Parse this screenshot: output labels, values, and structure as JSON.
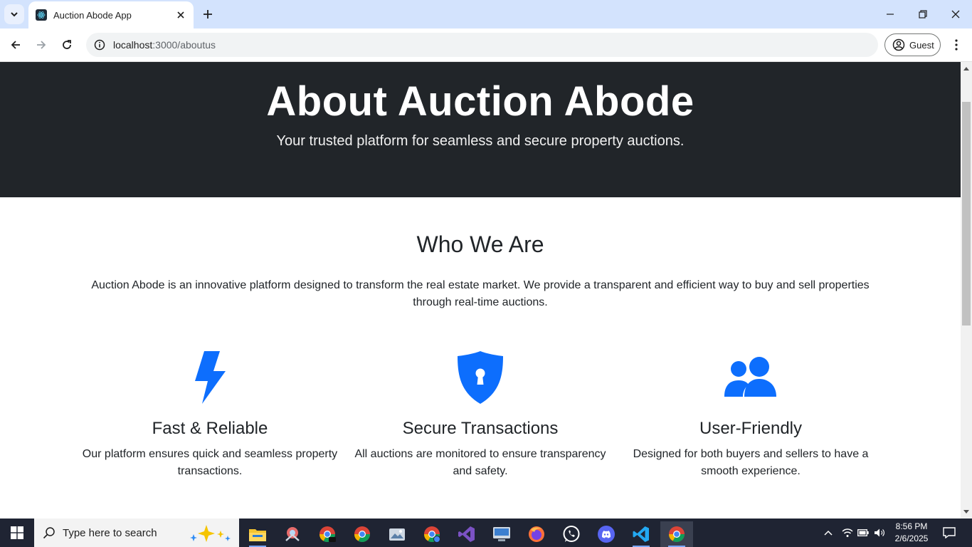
{
  "browser": {
    "tab_title": "Auction Abode App",
    "url_host": "localhost",
    "url_rest": ":3000/aboutus",
    "profile_label": "Guest"
  },
  "hero": {
    "title": "About Auction Abode",
    "subtitle": "Your trusted platform for seamless and secure property auctions."
  },
  "who": {
    "title": "Who We Are",
    "text": "Auction Abode is an innovative platform designed to transform the real estate market. We provide a transparent and efficient way to buy and sell properties through real-time auctions."
  },
  "features": [
    {
      "icon": "lightning-icon",
      "title": "Fast & Reliable",
      "text": "Our platform ensures quick and seamless property transactions."
    },
    {
      "icon": "shield-lock-icon",
      "title": "Secure Transactions",
      "text": "All auctions are monitored to ensure transparency and safety."
    },
    {
      "icon": "users-icon",
      "title": "User-Friendly",
      "text": "Designed for both buyers and sellers to have a smooth experience."
    }
  ],
  "colors": {
    "hero_bg": "#212529",
    "accent": "#0d6efd"
  },
  "taskbar": {
    "search_placeholder": "Type here to search",
    "time": "8:56 PM",
    "date": "2/6/2025"
  }
}
